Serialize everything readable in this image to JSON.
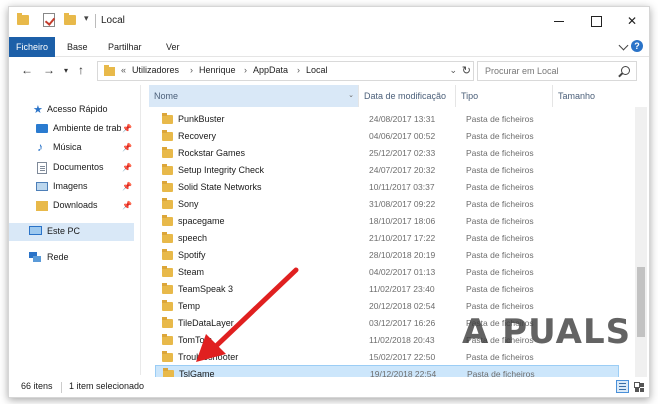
{
  "window": {
    "title": "Local"
  },
  "ribbon": {
    "tabs": [
      "Ficheiro",
      "Base",
      "Partilhar",
      "Ver"
    ]
  },
  "address": {
    "prefix": "«",
    "crumbs": [
      "Utilizadores",
      "Henrique",
      "AppData",
      "Local"
    ],
    "separator": "›"
  },
  "search": {
    "placeholder": "Procurar em Local"
  },
  "navpane": {
    "items": [
      {
        "label": "Acesso Rápido",
        "icon": "star-icon"
      },
      {
        "label": "Ambiente de trabalho",
        "icon": "desktop-icon",
        "pinned": true
      },
      {
        "label": "Música",
        "icon": "music-icon",
        "pinned": true
      },
      {
        "label": "Documentos",
        "icon": "documents-icon",
        "pinned": true
      },
      {
        "label": "Imagens",
        "icon": "pictures-icon",
        "pinned": true
      },
      {
        "label": "Downloads",
        "icon": "downloads-icon",
        "pinned": true
      },
      {
        "label": "Este PC",
        "icon": "computer-icon",
        "selected": true
      },
      {
        "label": "Rede",
        "icon": "network-icon"
      }
    ]
  },
  "columns": {
    "name": "Nome",
    "date": "Data de modificação",
    "type": "Tipo",
    "size": "Tamanho"
  },
  "files": [
    {
      "name": "PunkBuster",
      "date": "24/08/2017 13:31",
      "type": "Pasta de ficheiros"
    },
    {
      "name": "Recovery",
      "date": "04/06/2017 00:52",
      "type": "Pasta de ficheiros"
    },
    {
      "name": "Rockstar Games",
      "date": "25/12/2017 02:33",
      "type": "Pasta de ficheiros"
    },
    {
      "name": "Setup Integrity Check",
      "date": "24/07/2017 20:32",
      "type": "Pasta de ficheiros"
    },
    {
      "name": "Solid State Networks",
      "date": "10/11/2017 03:37",
      "type": "Pasta de ficheiros"
    },
    {
      "name": "Sony",
      "date": "31/08/2017 09:22",
      "type": "Pasta de ficheiros"
    },
    {
      "name": "spacegame",
      "date": "18/10/2017 18:06",
      "type": "Pasta de ficheiros"
    },
    {
      "name": "speech",
      "date": "21/10/2017 17:22",
      "type": "Pasta de ficheiros"
    },
    {
      "name": "Spotify",
      "date": "28/10/2018 20:19",
      "type": "Pasta de ficheiros"
    },
    {
      "name": "Steam",
      "date": "04/02/2017 01:13",
      "type": "Pasta de ficheiros"
    },
    {
      "name": "TeamSpeak 3",
      "date": "11/02/2017 23:40",
      "type": "Pasta de ficheiros"
    },
    {
      "name": "Temp",
      "date": "20/12/2018 02:54",
      "type": "Pasta de ficheiros"
    },
    {
      "name": "TileDataLayer",
      "date": "03/12/2017 16:26",
      "type": "Pasta de ficheiros"
    },
    {
      "name": "TomTom",
      "date": "11/02/2018 20:43",
      "type": "Pasta de ficheiros"
    },
    {
      "name": "Troubleshooter",
      "date": "15/02/2017 22:50",
      "type": "Pasta de ficheiros"
    },
    {
      "name": "TslGame",
      "date": "19/12/2018 22:54",
      "type": "Pasta de ficheiros",
      "selected": true
    }
  ],
  "status": {
    "count": "66 itens",
    "selection": "1 item selecionado"
  },
  "watermark": {
    "text": "A  PUALS"
  },
  "colors": {
    "accent": "#1c5fa8",
    "selection": "#cce6fb",
    "folder": "#e8b94a",
    "arrow": "#e02020"
  }
}
